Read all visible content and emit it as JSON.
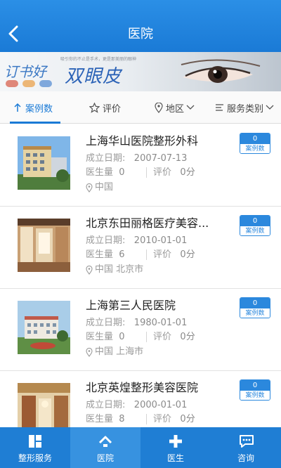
{
  "header": {
    "title": "医院"
  },
  "banner": {
    "brand": "订书好",
    "title": "双眼皮",
    "fine_print": "吸引你的不止是手术，更是那美丽的眼神"
  },
  "filters": [
    {
      "label": "案例数",
      "icon": "sort-icon",
      "active": true
    },
    {
      "label": "评价",
      "icon": "star-icon"
    },
    {
      "label": "地区",
      "icon": "location-icon"
    },
    {
      "label": "服务类别",
      "icon": "list-icon"
    }
  ],
  "hospitals": [
    {
      "name": "上海华山医院整形外科",
      "date_label": "成立日期:",
      "date": "2007-07-13",
      "doctor_label": "医生量",
      "doctors": "0",
      "rating_label": "评价",
      "rating": "0分",
      "location": "中国",
      "case_count": "0",
      "case_label": "案例数"
    },
    {
      "name": "北京东田丽格医疗美容...",
      "date_label": "成立日期:",
      "date": "2010-01-01",
      "doctor_label": "医生量",
      "doctors": "6",
      "rating_label": "评价",
      "rating": "0分",
      "location": "中国 北京市",
      "case_count": "0",
      "case_label": "案例数"
    },
    {
      "name": "上海第三人民医院",
      "date_label": "成立日期:",
      "date": "1980-01-01",
      "doctor_label": "医生量",
      "doctors": "0",
      "rating_label": "评价",
      "rating": "0分",
      "location": "中国 上海市",
      "case_count": "0",
      "case_label": "案例数"
    },
    {
      "name": "北京英煌整形美容医院",
      "date_label": "成立日期:",
      "date": "2000-01-01",
      "doctor_label": "医生量",
      "doctors": "8",
      "rating_label": "评价",
      "rating": "0分",
      "location": "",
      "case_count": "0",
      "case_label": "案例数"
    }
  ],
  "tabbar": [
    {
      "label": "整形服务",
      "icon": "grid-icon"
    },
    {
      "label": "医院",
      "icon": "hospital-icon",
      "active": true
    },
    {
      "label": "医生",
      "icon": "plus-icon"
    },
    {
      "label": "咨询",
      "icon": "chat-icon"
    }
  ],
  "colors": {
    "primary": "#1a7ad6",
    "tabbar": "#1f7ed4",
    "badge": "#2b88dd"
  }
}
